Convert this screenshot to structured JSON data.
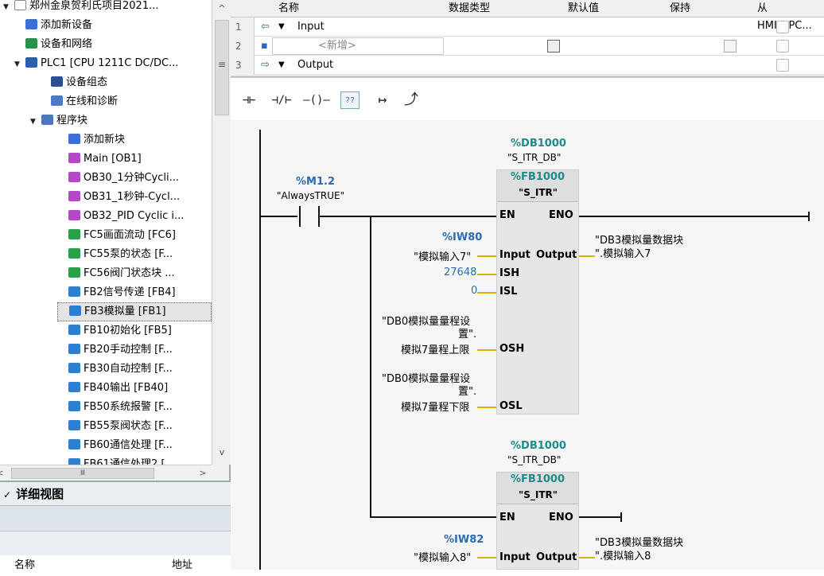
{
  "tree": {
    "items": [
      {
        "arrow": "▼",
        "icon": "project",
        "icon_color": "#ffffff",
        "label": "郑州金泉贺利氏项目2021..."
      },
      {
        "arrow": "",
        "icon": "add-device",
        "icon_color": "#3a6fd8",
        "label": "添加新设备"
      },
      {
        "arrow": "",
        "icon": "network",
        "icon_color": "#2c8f4a",
        "label": "设备和网络"
      },
      {
        "arrow": "▼",
        "icon": "plc",
        "icon_color": "#2d5ea8",
        "label": "PLC1 [CPU 1211C DC/DC..."
      },
      {
        "arrow": "",
        "icon": "device-config",
        "icon_color": "#2b4f8f",
        "label": "设备组态"
      },
      {
        "arrow": "",
        "icon": "online-diagnostics",
        "icon_color": "#4a7bc0",
        "label": "在线和诊断"
      },
      {
        "arrow": "▼",
        "icon": "program-blocks",
        "icon_color": "#4a78b8",
        "label": "程序块"
      },
      {
        "arrow": "",
        "icon": "add-block",
        "icon_color": "#3a6fd8",
        "label": "添加新块"
      },
      {
        "arrow": "",
        "icon": "ob",
        "icon_color": "#b24ac4",
        "label": "Main [OB1]"
      },
      {
        "arrow": "",
        "icon": "ob",
        "icon_color": "#b24ac4",
        "label": "OB30_1分钟Cycli..."
      },
      {
        "arrow": "",
        "icon": "ob",
        "icon_color": "#b24ac4",
        "label": "OB31_1秒钟-Cycl..."
      },
      {
        "arrow": "",
        "icon": "ob",
        "icon_color": "#b24ac4",
        "label": "OB32_PID Cyclic i..."
      },
      {
        "arrow": "",
        "icon": "fc",
        "icon_color": "#2aa148",
        "label": "FC5画面流动 [FC6]"
      },
      {
        "arrow": "",
        "icon": "fc",
        "icon_color": "#2aa148",
        "label": "FC55泵的状态 [F..."
      },
      {
        "arrow": "",
        "icon": "fc",
        "icon_color": "#2aa148",
        "label": "FC56阀门状态块 ..."
      },
      {
        "arrow": "",
        "icon": "fb",
        "icon_color": "#2f7fd0",
        "label": "FB2信号传递 [FB4]"
      },
      {
        "arrow": "",
        "icon": "fb",
        "icon_color": "#2f7fd0",
        "label": "FB3模拟量 [FB1]"
      },
      {
        "arrow": "",
        "icon": "fb",
        "icon_color": "#2f7fd0",
        "label": "FB10初始化 [FB5]"
      },
      {
        "arrow": "",
        "icon": "fb",
        "icon_color": "#2f7fd0",
        "label": "FB20手动控制 [F..."
      },
      {
        "arrow": "",
        "icon": "fb",
        "icon_color": "#2f7fd0",
        "label": "FB30自动控制 [F..."
      },
      {
        "arrow": "",
        "icon": "fb",
        "icon_color": "#2f7fd0",
        "label": "FB40输出 [FB40]"
      },
      {
        "arrow": "",
        "icon": "fb",
        "icon_color": "#2f7fd0",
        "label": "FB50系统报警 [F..."
      },
      {
        "arrow": "",
        "icon": "fb",
        "icon_color": "#2f7fd0",
        "label": "FB55泵阀状态 [F..."
      },
      {
        "arrow": "",
        "icon": "fb",
        "icon_color": "#2f7fd0",
        "label": "FB60通信处理 [F..."
      },
      {
        "arrow": "",
        "icon": "fb",
        "icon_color": "#2f7fd0",
        "label": "FB61通信处理2 [..."
      }
    ],
    "scroll_thumb_glyph": "Ⅲ",
    "scroll_left": "<",
    "scroll_right": ">",
    "scroll_up": "^",
    "scroll_down": "v",
    "scroll_grip": "≡"
  },
  "detail": {
    "toggle": "✓",
    "title": "详细视图",
    "col_name": "名称",
    "col_address": "地址"
  },
  "interface": {
    "headers": {
      "name": "名称",
      "type": "数据类型",
      "default": "默认值",
      "retain": "保持",
      "hmi": "从 HMI/OPC..."
    },
    "rows": [
      {
        "num": "1",
        "tag": "⇦",
        "arrow": "▼",
        "name": "Input"
      },
      {
        "num": "2",
        "tag": "▪",
        "arrow": "",
        "name": "<新增>"
      },
      {
        "num": "3",
        "tag": "⇨",
        "arrow": "▼",
        "name": "Output"
      }
    ]
  },
  "toolbar": {
    "no_contact": "⊣⊢",
    "nc_contact": "⊣/⊢",
    "coil": "—()—",
    "empty_box": "??",
    "open_branch": "↦",
    "close_branch": "⤴"
  },
  "ladder": {
    "contact": {
      "address": "%M1.2",
      "tag": "\"AlwaysTRUE\""
    },
    "block1": {
      "db_addr": "%DB1000",
      "db_name": "\"S_ITR_DB\"",
      "fb_addr": "%FB1000",
      "fb_name": "\"S_ITR\"",
      "pins_in": [
        "EN",
        "Input",
        "ISH",
        "ISL",
        "OSH",
        "OSL"
      ],
      "pins_out": [
        "ENO",
        "Output"
      ],
      "input_addr": "%IW80",
      "input_tag": "\"模拟输入7\"",
      "ish": "27648",
      "isl": "0",
      "osh_l1": "\"DB0模拟量量程设",
      "osh_l2": "置\".",
      "osh_l3": "模拟7量程上限",
      "osl_l1": "\"DB0模拟量量程设",
      "osl_l2": "置\".",
      "osl_l3": "模拟7量程下限",
      "out_l1": "\"DB3模拟量数据块",
      "out_l2": "\".模拟输入7"
    },
    "block2": {
      "db_addr": "%DB1000",
      "db_name": "\"S_ITR_DB\"",
      "fb_addr": "%FB1000",
      "fb_name": "\"S_ITR\"",
      "pins_in": [
        "EN",
        "Input"
      ],
      "pins_out": [
        "ENO",
        "Output"
      ],
      "input_addr": "%IW82",
      "input_tag": "\"模拟输入8\"",
      "out_l1": "\"DB3模拟量数据块",
      "out_l2": "\".模拟输入8"
    }
  }
}
